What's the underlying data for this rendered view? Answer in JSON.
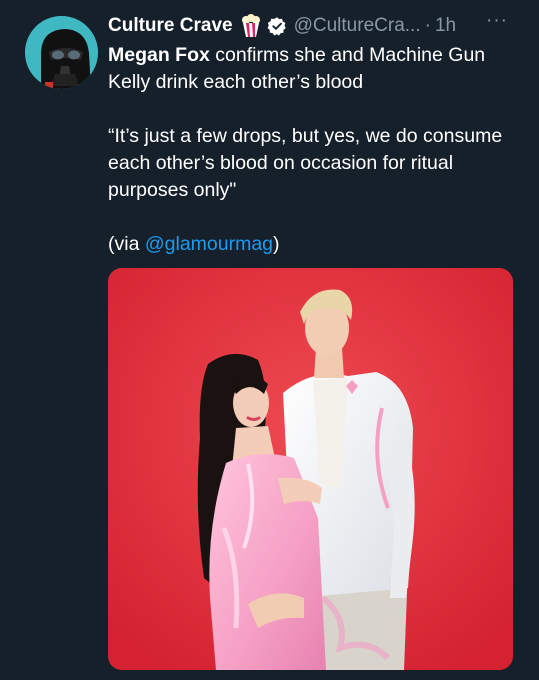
{
  "author": {
    "display_name": "Culture Crave",
    "handle": "@CultureCra...",
    "separator": "·",
    "time": "1h",
    "emoji_icon": "popcorn-icon",
    "verified_icon": "verified-badge-icon"
  },
  "more_label": "···",
  "tweet": {
    "subject": "Megan Fox",
    "line1_rest": " confirms she and Machine Gun Kelly drink each other’s blood",
    "quote": "“It’s just a few drops, but yes, we do consume each other’s blood on occasion for ritual purposes only\"",
    "via_prefix": "(via ",
    "via_mention": "@glamourmag",
    "via_suffix": ")"
  },
  "colors": {
    "background": "#15202b",
    "text": "#ffffff",
    "secondary": "#8899a6",
    "link": "#1d9bf0",
    "photo_backdrop": "#e3303a",
    "avatar_bg": "#3fb8c2"
  }
}
